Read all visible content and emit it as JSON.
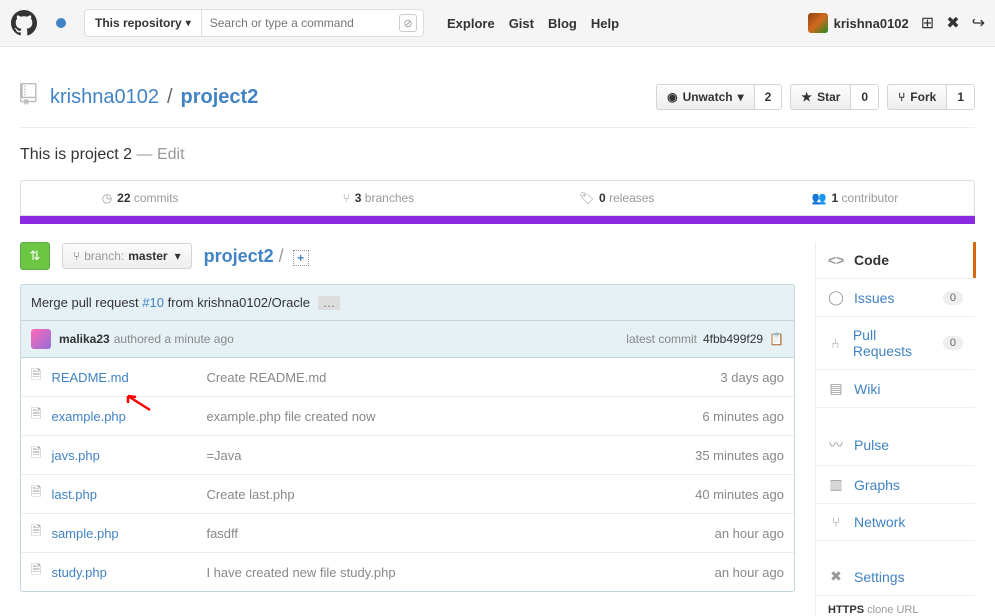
{
  "header": {
    "search_scope": "This repository",
    "search_placeholder": "Search or type a command",
    "nav": [
      "Explore",
      "Gist",
      "Blog",
      "Help"
    ],
    "username": "krishna0102"
  },
  "repo": {
    "owner": "krishna0102",
    "name": "project2",
    "watch_label": "Unwatch",
    "watch_count": "2",
    "star_label": "Star",
    "star_count": "0",
    "fork_label": "Fork",
    "fork_count": "1",
    "description": "This is project 2",
    "edit_label": " — Edit"
  },
  "stats": {
    "commits_n": "22",
    "commits_l": "commits",
    "branches_n": "3",
    "branches_l": "branches",
    "releases_n": "0",
    "releases_l": "releases",
    "contrib_n": "1",
    "contrib_l": "contributor"
  },
  "branch": {
    "label": "branch:",
    "value": "master",
    "breadcrumb": "project2"
  },
  "commit": {
    "msg_prefix": "Merge pull request ",
    "pr_link": "#10",
    "msg_suffix": " from krishna0102/Oracle",
    "ellipsis": "…",
    "author": "malika23",
    "authored": " authored a minute ago",
    "latest_label": "latest commit ",
    "hash": "4fbb499f29"
  },
  "files": [
    {
      "name": "README.md",
      "msg": "Create README.md",
      "time": "3 days ago"
    },
    {
      "name": "example.php",
      "msg": "example.php file created now",
      "time": "6 minutes ago"
    },
    {
      "name": "javs.php",
      "msg": "=Java",
      "time": "35 minutes ago"
    },
    {
      "name": "last.php",
      "msg": "Create last.php",
      "time": "40 minutes ago"
    },
    {
      "name": "sample.php",
      "msg": "fasdff",
      "time": "an hour ago"
    },
    {
      "name": "study.php",
      "msg": "I have created new file study.php",
      "time": "an hour ago"
    }
  ],
  "sidebar": {
    "code": "Code",
    "issues": "Issues",
    "issues_count": "0",
    "pulls": "Pull Requests",
    "pulls_count": "0",
    "wiki": "Wiki",
    "pulse": "Pulse",
    "graphs": "Graphs",
    "network": "Network",
    "settings": "Settings",
    "clone_proto": "HTTPS",
    "clone_label": " clone URL"
  }
}
